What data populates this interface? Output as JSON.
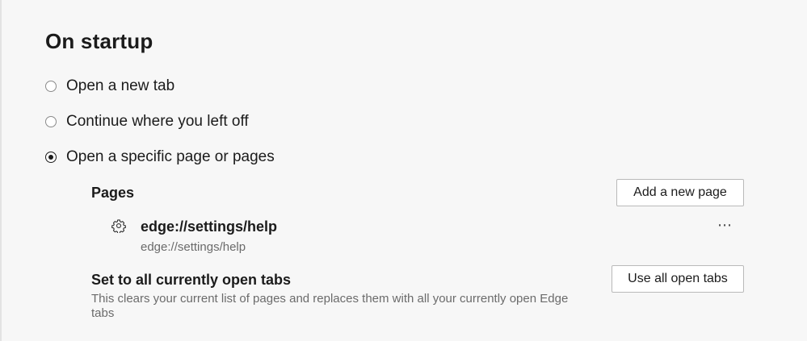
{
  "section": {
    "title": "On startup"
  },
  "startup_options": [
    {
      "label": "Open a new tab",
      "checked": false
    },
    {
      "label": "Continue where you left off",
      "checked": false
    },
    {
      "label": "Open a specific page or pages",
      "checked": true
    }
  ],
  "pages": {
    "heading": "Pages",
    "add_button_label": "Add a new page",
    "items": [
      {
        "icon": "gear-icon",
        "title": "edge://settings/help",
        "url": "edge://settings/help",
        "more_label": "⋯"
      }
    ]
  },
  "open_tabs": {
    "heading": "Set to all currently open tabs",
    "description": "This clears your current list of pages and replaces them with all your currently open Edge tabs",
    "button_label": "Use all open tabs"
  },
  "colors": {
    "background": "#f7f7f7",
    "text": "#1b1b1b",
    "secondary_text": "#6b6b6b",
    "button_border": "#b9b9b9"
  }
}
